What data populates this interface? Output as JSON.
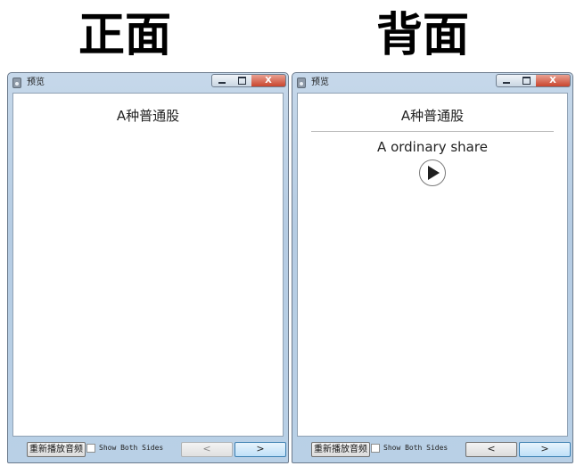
{
  "headings": {
    "front": "正面",
    "back": "背面"
  },
  "window": {
    "title": "预览",
    "controls": {
      "close_label": "X"
    }
  },
  "front_card": {
    "text": "A种普通股"
  },
  "back_card": {
    "front_text": "A种普通股",
    "back_text": "A ordinary share"
  },
  "bottombar": {
    "replay_label": "重新播放音频",
    "show_both_label": "Show Both Sides",
    "show_both_checked": false,
    "prev_label": "<",
    "next_label": ">"
  },
  "colors": {
    "close": "#c9442d",
    "next_accent": "#3c7fb1"
  },
  "icons": [
    "app-icon",
    "minimize-icon",
    "maximize-icon",
    "close-icon",
    "play-icon"
  ]
}
